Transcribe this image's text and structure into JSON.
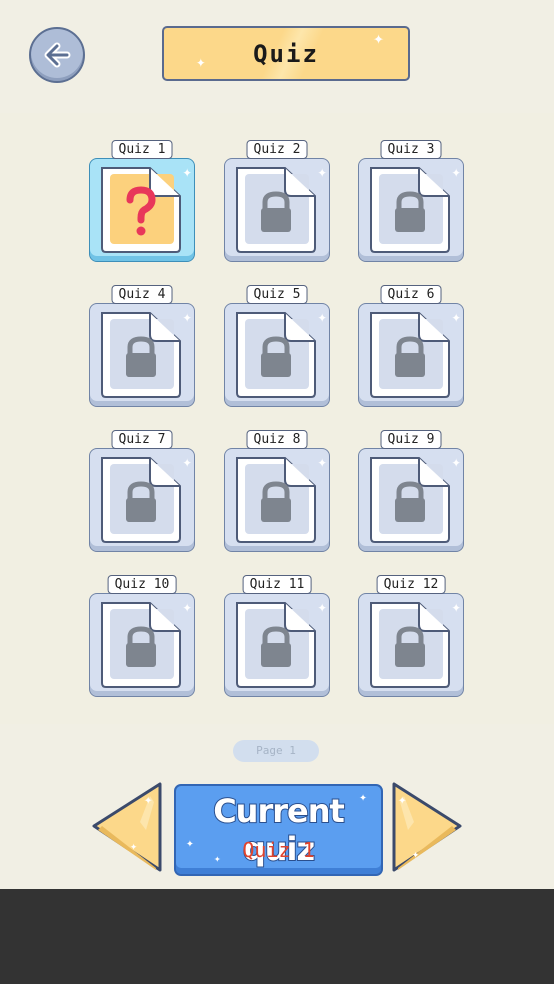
{
  "header": {
    "title": "Quiz",
    "back_icon": "back-arrow-icon"
  },
  "levels": [
    {
      "label": "Quiz 1",
      "state": "active",
      "icon": "question-mark-icon"
    },
    {
      "label": "Quiz 2",
      "state": "locked",
      "icon": "lock-icon"
    },
    {
      "label": "Quiz 3",
      "state": "locked",
      "icon": "lock-icon"
    },
    {
      "label": "Quiz 4",
      "state": "locked",
      "icon": "lock-icon"
    },
    {
      "label": "Quiz 5",
      "state": "locked",
      "icon": "lock-icon"
    },
    {
      "label": "Quiz 6",
      "state": "locked",
      "icon": "lock-icon"
    },
    {
      "label": "Quiz 7",
      "state": "locked",
      "icon": "lock-icon"
    },
    {
      "label": "Quiz 8",
      "state": "locked",
      "icon": "lock-icon"
    },
    {
      "label": "Quiz 9",
      "state": "locked",
      "icon": "lock-icon"
    },
    {
      "label": "Quiz 10",
      "state": "locked",
      "icon": "lock-icon"
    },
    {
      "label": "Quiz 11",
      "state": "locked",
      "icon": "lock-icon"
    },
    {
      "label": "Quiz 12",
      "state": "locked",
      "icon": "lock-icon"
    }
  ],
  "pagination": {
    "page_label": "Page 1"
  },
  "current": {
    "title": "Current quiz",
    "value": "Quiz 1"
  },
  "colors": {
    "accent_blue": "#5b9ef0",
    "accent_yellow": "#fcd88a",
    "active_card": "#a9e3f7",
    "locked_card": "#d6dff0",
    "question_mark": "#e8375a",
    "current_value_text": "#e0442d"
  }
}
